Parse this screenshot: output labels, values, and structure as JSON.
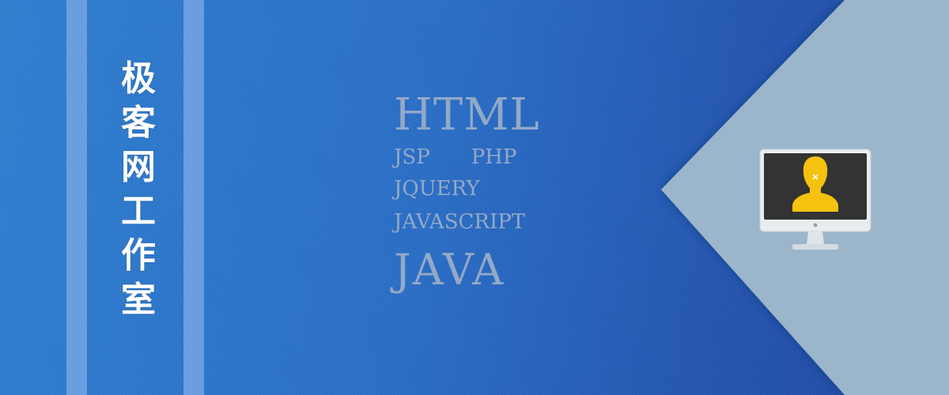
{
  "title_chars": [
    "极",
    "客",
    "网",
    "工",
    "作",
    "室"
  ],
  "tech": {
    "html": "HTML",
    "jsp": "JSP",
    "php": "PHP",
    "jquery": "JQUERY",
    "javascript": "JAVASCRIPT",
    "java": "JAVA"
  },
  "icons": {
    "monitor": "monitor-user-icon"
  },
  "colors": {
    "background": "#2a6ec6",
    "stripe": "#6b9ee0",
    "panel": "#9bb5ca",
    "tech_text": "#93a9c7",
    "avatar": "#f5c20f"
  }
}
